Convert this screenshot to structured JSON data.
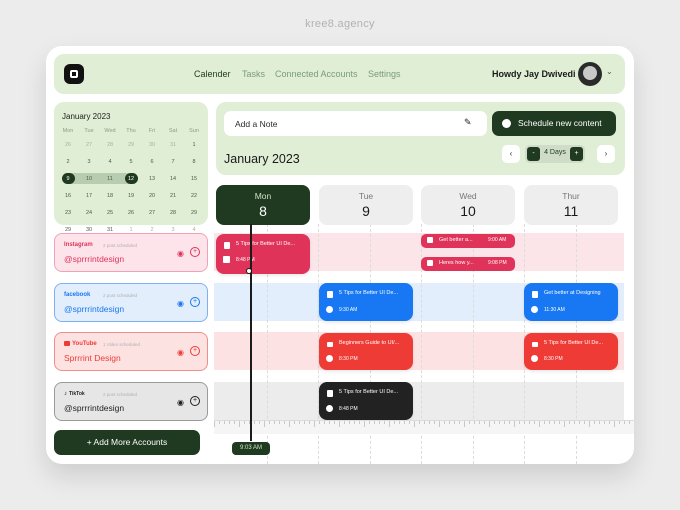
{
  "brand": "kree8.agency",
  "nav": {
    "items": [
      "Calender",
      "Tasks",
      "Connected Accounts",
      "Settings"
    ],
    "active": "Calender",
    "greeting": "Howdy Jay Dwivedi"
  },
  "mini_calendar": {
    "title": "January 2023",
    "weekdays": [
      "Mon",
      "Tue",
      "Wed",
      "Thu",
      "Fri",
      "Sat",
      "Sun"
    ],
    "weeks": [
      [
        "26",
        "27",
        "28",
        "29",
        "30",
        "31",
        "1"
      ],
      [
        "2",
        "3",
        "4",
        "5",
        "6",
        "7",
        "8"
      ],
      [
        "9",
        "10",
        "11",
        "12",
        "13",
        "14",
        "15"
      ],
      [
        "16",
        "17",
        "18",
        "19",
        "20",
        "21",
        "22"
      ],
      [
        "23",
        "24",
        "25",
        "26",
        "27",
        "28",
        "29"
      ],
      [
        "29",
        "30",
        "31",
        "1",
        "2",
        "3",
        "4"
      ]
    ],
    "selected_range": [
      "8",
      "11"
    ]
  },
  "note": {
    "placeholder": "Add a Note",
    "schedule_label": "Schedule new content",
    "month_label": "January 2023",
    "days_label": "4 Days",
    "minus": "-",
    "plus": "+",
    "prev": "‹",
    "next": "›"
  },
  "days": [
    {
      "name": "Mon",
      "date": "8",
      "active": true
    },
    {
      "name": "Tue",
      "date": "9",
      "active": false
    },
    {
      "name": "Wed",
      "date": "10",
      "active": false
    },
    {
      "name": "Thur",
      "date": "11",
      "active": false
    }
  ],
  "accounts": [
    {
      "platform": "Instagram",
      "scheduled": "2 post scheduled",
      "handle": "@sprrrintdesign",
      "color": "#e0335a"
    },
    {
      "platform": "facebook",
      "scheduled": "2 post scheduled",
      "handle": "@sprrrintdesign",
      "color": "#1877f2"
    },
    {
      "platform": "YouTube",
      "scheduled": "1 Video scheduled",
      "handle": "Sprrrint Design",
      "color": "#ef3b36"
    },
    {
      "platform": "TikTok",
      "scheduled": "2 post scheduled",
      "handle": "@sprrrintdesign",
      "color": "#1f1f1f"
    }
  ],
  "posts": {
    "mon_instagram": {
      "title": "5 Tips for Better UI  De...",
      "time": "8:48 PM"
    },
    "wed_instagram_1": {
      "title": "Get better a...",
      "time": "9:00 AM"
    },
    "wed_instagram_2": {
      "title": "Heres how y...",
      "time": "9:08 PM"
    },
    "tue_facebook": {
      "title": "5 Tips for Better UI  De...",
      "time": "9:30 AM"
    },
    "thu_facebook": {
      "title": "Get better at Designing",
      "time": "11:30 AM"
    },
    "tue_youtube": {
      "title": "Beginners Guide to UI/...",
      "time": "8:30 PM"
    },
    "thu_youtube": {
      "title": "5 Tips for Better UI  De...",
      "time": "8:30 PM"
    },
    "tue_tiktok": {
      "title": "5 Tips for Better UI  De...",
      "time": "8:48 PM"
    }
  },
  "add_accounts_label": "+ Add More Accounts",
  "current_time": "9:03 AM",
  "colors": {
    "primary": "#1f3a21",
    "panel": "#dfeed5",
    "instagram": "#e0335a",
    "facebook": "#1877f2",
    "youtube": "#ef3b36",
    "tiktok": "#1f1f1f"
  }
}
